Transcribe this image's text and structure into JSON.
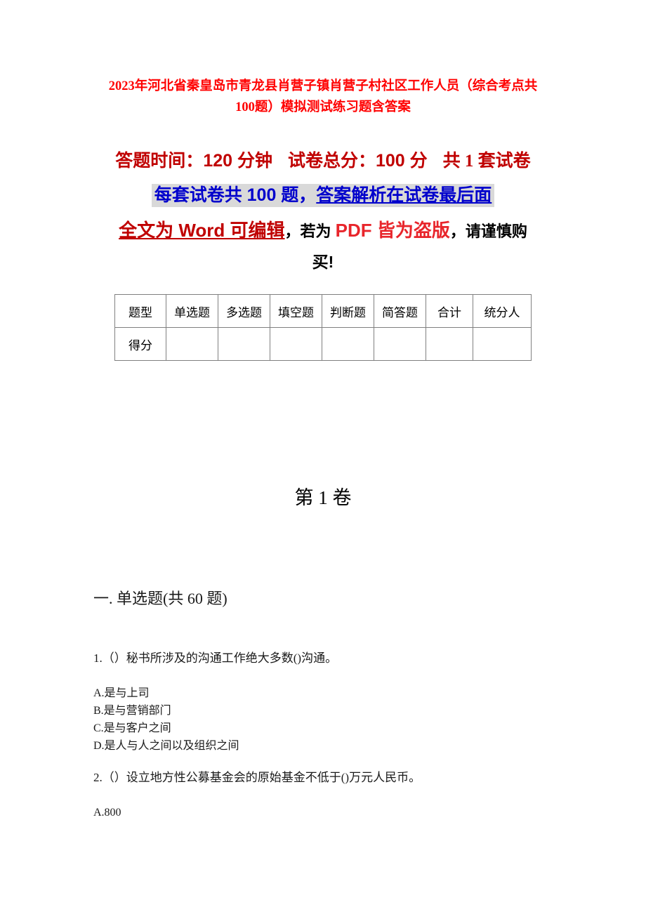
{
  "document": {
    "title": "2023年河北省秦皇岛市青龙县肖营子镇肖营子村社区工作人员（综合考点共100题）模拟测试练习题含答案",
    "colors": {
      "title_red": "#FF0000",
      "dark_red": "#C00000",
      "bright_red": "#E8252B",
      "highlight_blue": "#0000CC",
      "highlight_background": "#D9D9D9",
      "table_border": "#808080",
      "body_text": "#1A1A1A"
    }
  },
  "info": {
    "line1": {
      "duration_label": "答题时间：",
      "duration_value": "120 分钟",
      "total_label": "试卷总分：",
      "total_value": "100 分",
      "sets_text": "共 1 套试卷"
    },
    "line2": {
      "prefix": "每套试卷共 100 题，",
      "underlined": "答案解析在试卷最后面"
    },
    "line3": {
      "seg_word": "全文为 Word 可编辑",
      "seg_ruowei": "，若为 ",
      "seg_pdf": "PDF 皆为盗版",
      "seg_tail": "，请谨慎购"
    },
    "line4": "买!"
  },
  "score_table": {
    "headers": [
      "题型",
      "单选题",
      "多选题",
      "填空题",
      "判断题",
      "简答题",
      "合计",
      "统分人"
    ],
    "rows": [
      {
        "label": "得分",
        "cells": [
          "",
          "",
          "",
          "",
          "",
          "",
          ""
        ]
      }
    ]
  },
  "volume": {
    "heading": "第 1 卷"
  },
  "section": {
    "heading": "一. 单选题(共 60 题)"
  },
  "questions": [
    {
      "number": "1.",
      "text": "1.（）秘书所涉及的沟通工作绝大多数()沟通。",
      "options": [
        "A.是与上司",
        "B.是与营销部门",
        "C.是与客户之间",
        "D.是人与人之间以及组织之间"
      ]
    },
    {
      "number": "2.",
      "text": "2.（）设立地方性公募基金会的原始基金不低于()万元人民币。",
      "options": [
        "A.800"
      ]
    }
  ]
}
